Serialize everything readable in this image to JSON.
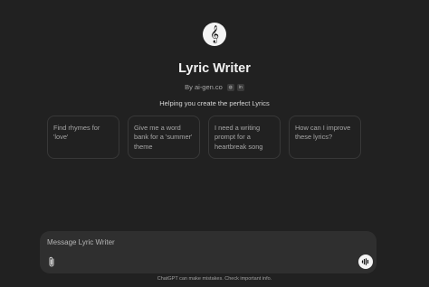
{
  "gpt": {
    "icon": "treble-clef-icon",
    "icon_glyph": "𝄞",
    "name": "Lyric Writer",
    "byline": "By ai-gen.co",
    "byline_links": [
      {
        "icon": "globe-icon",
        "glyph": "◍"
      },
      {
        "icon": "linkedin-icon",
        "glyph": "in"
      }
    ],
    "tagline": "Helping you create the perfect Lyrics"
  },
  "starters": [
    {
      "text": "Find rhymes for 'love'"
    },
    {
      "text": "Give me a word bank for a 'summer' theme"
    },
    {
      "text": "I need a writing prompt for a heartbreak song"
    },
    {
      "text": "How can I improve these lyrics?"
    }
  ],
  "composer": {
    "placeholder": "Message Lyric Writer",
    "value": "",
    "attach_icon": "paperclip-icon",
    "voice_icon": "voice-mode-icon"
  },
  "footer": {
    "disclaimer": "ChatGPT can make mistakes. Check important info."
  }
}
